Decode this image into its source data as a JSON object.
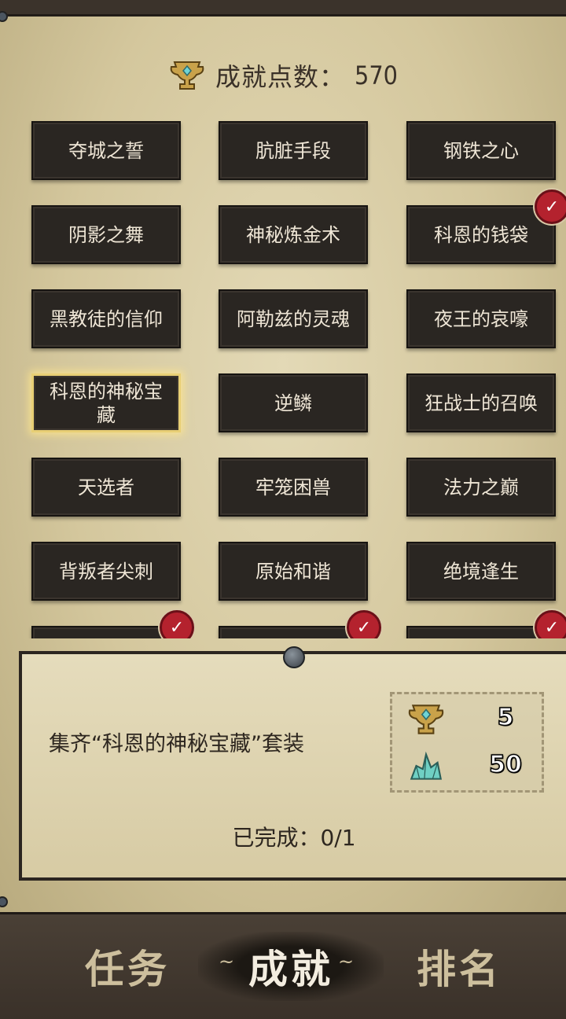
{
  "header": {
    "label": "成就点数：",
    "value": "570",
    "icon": "trophy-icon"
  },
  "achievements": [
    {
      "label": "夺城之誓",
      "completed": false
    },
    {
      "label": "肮脏手段",
      "completed": false
    },
    {
      "label": "钢铁之心",
      "completed": false
    },
    {
      "label": "阴影之舞",
      "completed": false
    },
    {
      "label": "神秘炼金术",
      "completed": false
    },
    {
      "label": "科恩的钱袋",
      "completed": true
    },
    {
      "label": "黑教徒的信仰",
      "completed": false
    },
    {
      "label": "阿勒兹的灵魂",
      "completed": false
    },
    {
      "label": "夜王的哀嚎",
      "completed": false
    },
    {
      "label": "科恩的神秘宝藏",
      "completed": false,
      "selected": true
    },
    {
      "label": "逆鳞",
      "completed": false
    },
    {
      "label": "狂战士的召唤",
      "completed": false
    },
    {
      "label": "天选者",
      "completed": false
    },
    {
      "label": "牢笼困兽",
      "completed": false
    },
    {
      "label": "法力之巅",
      "completed": false
    },
    {
      "label": "背叛者尖刺",
      "completed": false
    },
    {
      "label": "原始和谐",
      "completed": false
    },
    {
      "label": "绝境逢生",
      "completed": false
    },
    {
      "label": "",
      "completed": true
    },
    {
      "label": "",
      "completed": true
    },
    {
      "label": "",
      "completed": true
    }
  ],
  "detail": {
    "description": "集齐“科恩的神秘宝藏”套装",
    "rewards": [
      {
        "icon": "trophy-icon",
        "value": "5"
      },
      {
        "icon": "crystal-icon",
        "value": "50"
      }
    ],
    "progress": "已完成：0/1"
  },
  "nav": {
    "tabs": [
      {
        "label": "任务",
        "active": false
      },
      {
        "label": "成就",
        "active": true
      },
      {
        "label": "排名",
        "active": false
      }
    ]
  },
  "colors": {
    "parchment": "#d4c79d",
    "card": "#2a2622",
    "selected_border": "#e8cf75",
    "check_badge": "#b4222e"
  }
}
